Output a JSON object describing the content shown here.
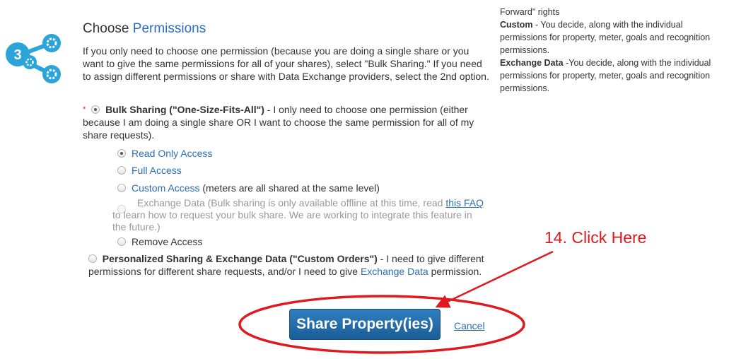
{
  "sidebar": {
    "line1": "Forward\" rights",
    "custom_label": "Custom",
    "custom_text": " - You decide, along with the individual permissions for property, meter, goals and recognition permissions.",
    "exchange_label": "Exchange Data",
    "exchange_text": " -You decide, along with the individual permissions for property, meter, goals and recognition permissions."
  },
  "step": {
    "number": "3"
  },
  "section": {
    "title_prefix": "Choose ",
    "title_highlight": "Permissions",
    "intro": "If you only need to choose one permission (because you are doing a single share or you want to give the same permissions for all of your shares), select \"Bulk Sharing.\" If you need to assign different permissions or share with Data Exchange providers, select the 2nd option."
  },
  "bulk": {
    "required_mark": "*",
    "label": "Bulk Sharing (\"One-Size-Fits-All\")",
    "description": " - I only need to choose one permission (either because I am doing a single share OR I want to choose the same permission for all of my share requests).",
    "options": [
      {
        "label": "Read Only Access",
        "selected": true
      },
      {
        "label": "Full Access"
      },
      {
        "label": "Custom Access",
        "suffix": " (meters are all shared at the same level)"
      },
      {
        "label": "Exchange Data (Bulk sharing is only available offline at this time, read ",
        "link": "this FAQ",
        "suffix": " to learn how to request your bulk share. We are working to integrate this feature in the future.)"
      },
      {
        "label": "Remove Access"
      }
    ]
  },
  "personalized": {
    "label": "Personalized Sharing & Exchange Data (\"Custom Orders\")",
    "description_pre": " - I need to give different permissions for different share requests, and/or I need to give ",
    "description_link": "Exchange Data",
    "description_post": " permission."
  },
  "actions": {
    "share_label": "Share Property(ies)",
    "cancel_label": "Cancel"
  },
  "annotation": {
    "text": "14. Click Here",
    "color": "#e0191f"
  }
}
